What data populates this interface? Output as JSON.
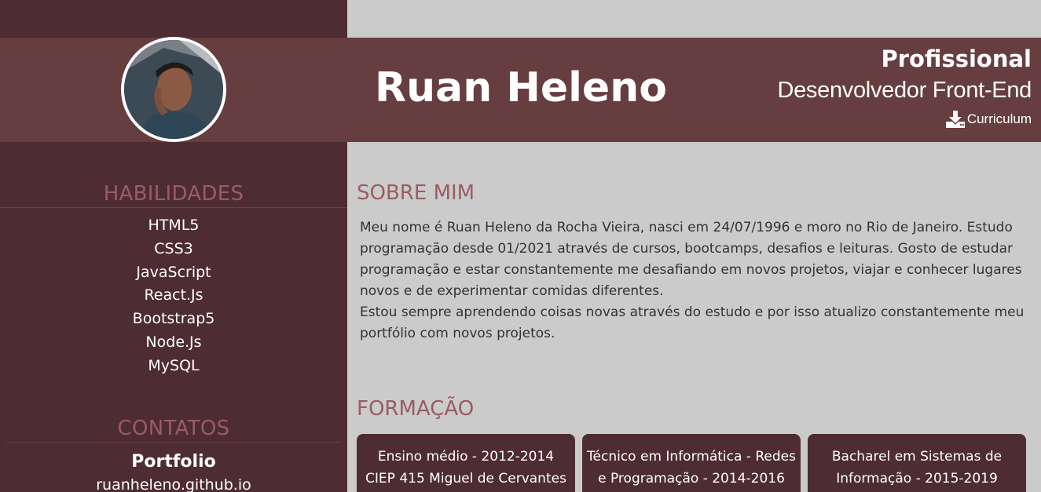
{
  "header": {
    "name": "Ruan Heleno",
    "profile_label": "Profissional",
    "role": "Desenvolvedor Front-End",
    "cv_label": "Curriculum"
  },
  "colors": {
    "sidebar": "#4e2c33",
    "header": "#673e3f",
    "accent": "#9a5c63",
    "background": "#cbcbcb"
  },
  "icons": {
    "download": "download-icon",
    "avatar": "profile-photo"
  },
  "skills": {
    "title": "HABILIDADES",
    "items": [
      "HTML5",
      "CSS3",
      "JavaScript",
      "React.Js",
      "Bootstrap5",
      "Node.Js",
      "MySQL"
    ]
  },
  "contacts": {
    "title": "CONTATOS",
    "portfolio_label": "Portfolio",
    "portfolio_value": "ruanheleno.github.io"
  },
  "about": {
    "title": "SOBRE MIM",
    "paragraph1": "Meu nome é Ruan Heleno da Rocha Vieira, nasci em 24/07/1996 e moro no Rio de Janeiro. Estudo programação desde 01/2021 através de cursos, bootcamps, desafios e leituras. Gosto de estudar programação e estar constantemente me desafiando em novos projetos, viajar e conhecer lugares novos e de experimentar comidas diferentes.",
    "paragraph2": "Estou sempre aprendendo coisas novas através do estudo e por isso atualizo constantemente meu portfólio com novos projetos."
  },
  "education": {
    "title": "FORMAÇÃO",
    "cards": [
      {
        "line1": "Ensino médio - 2012-2014",
        "line2": "CIEP 415 Miguel de Cervantes"
      },
      {
        "line1": "Técnico em Informática - Redes",
        "line2": "e Programação - 2014-2016"
      },
      {
        "line1": "Bacharel em Sistemas de",
        "line2": "Informação - 2015-2019"
      }
    ]
  }
}
